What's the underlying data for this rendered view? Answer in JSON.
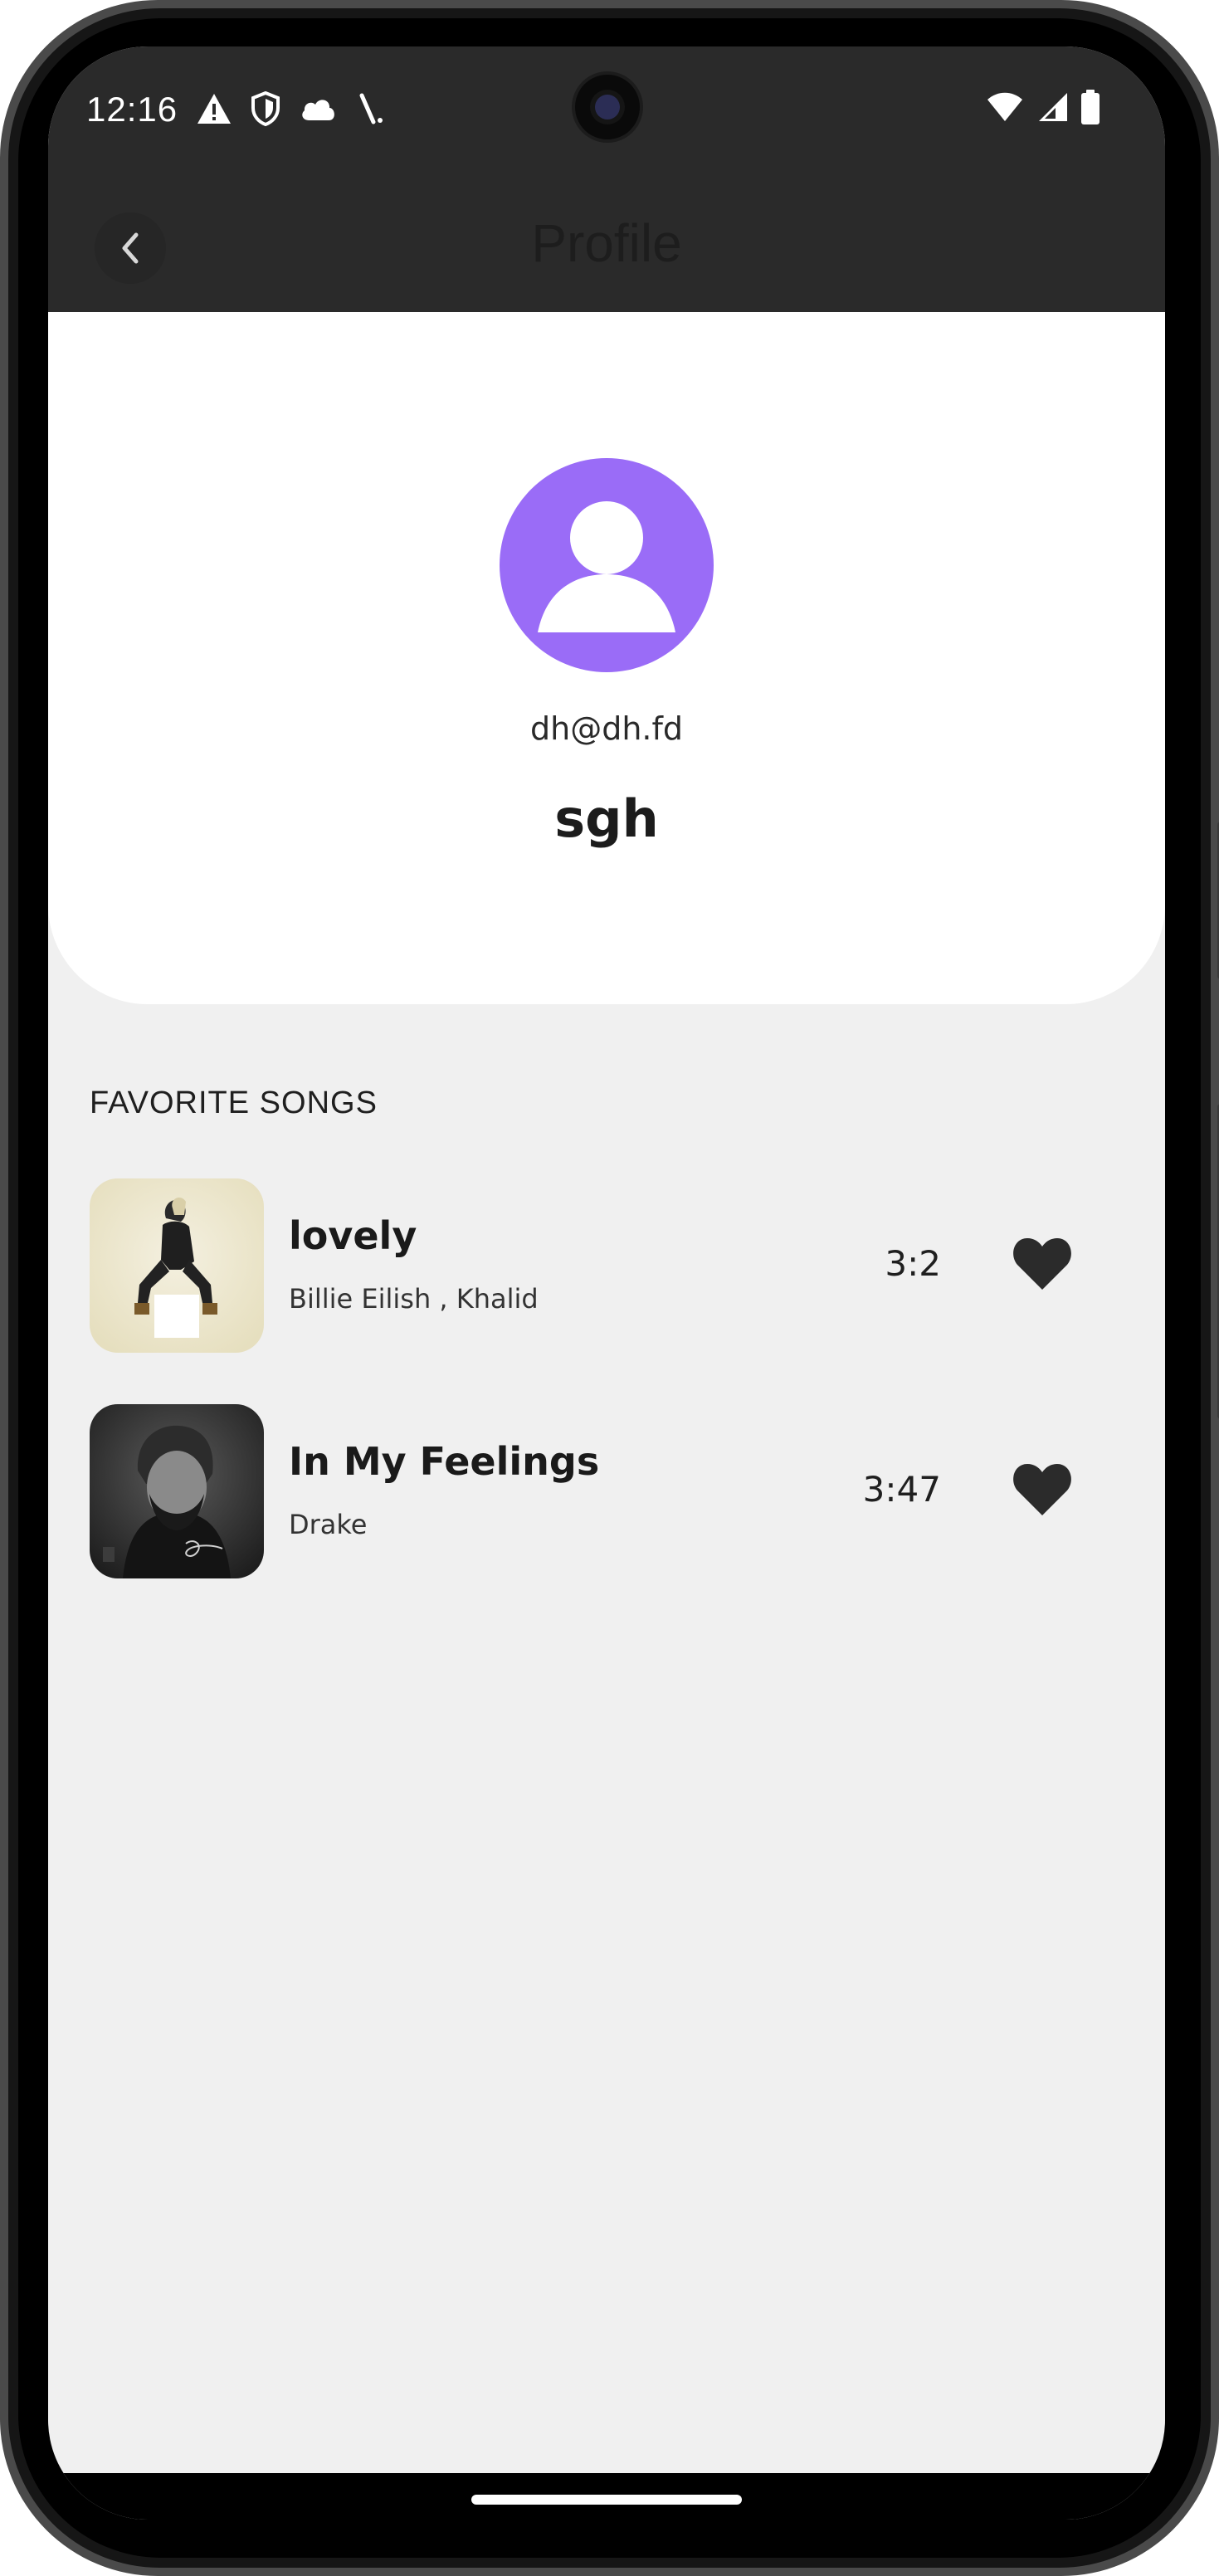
{
  "status_bar": {
    "time": "12:16",
    "left_icons": [
      "warning-icon",
      "shield-icon",
      "cloud-icon",
      "signal-slash-icon"
    ],
    "right_icons": [
      "wifi-icon",
      "cell-signal-icon",
      "battery-icon"
    ]
  },
  "header": {
    "title": "Profile",
    "back_icon": "chevron-left-icon"
  },
  "profile": {
    "email": "dh@dh.fd",
    "username": "sgh",
    "avatar_color": "#9a6cf7"
  },
  "favorites": {
    "section_title": "FAVORITE SONGS",
    "songs": [
      {
        "title": "lovely",
        "artist": "Billie Eilish , Khalid",
        "duration": "3:2",
        "liked": true
      },
      {
        "title": "In My Feelings",
        "artist": "Drake",
        "duration": "3:47",
        "liked": true
      }
    ]
  }
}
